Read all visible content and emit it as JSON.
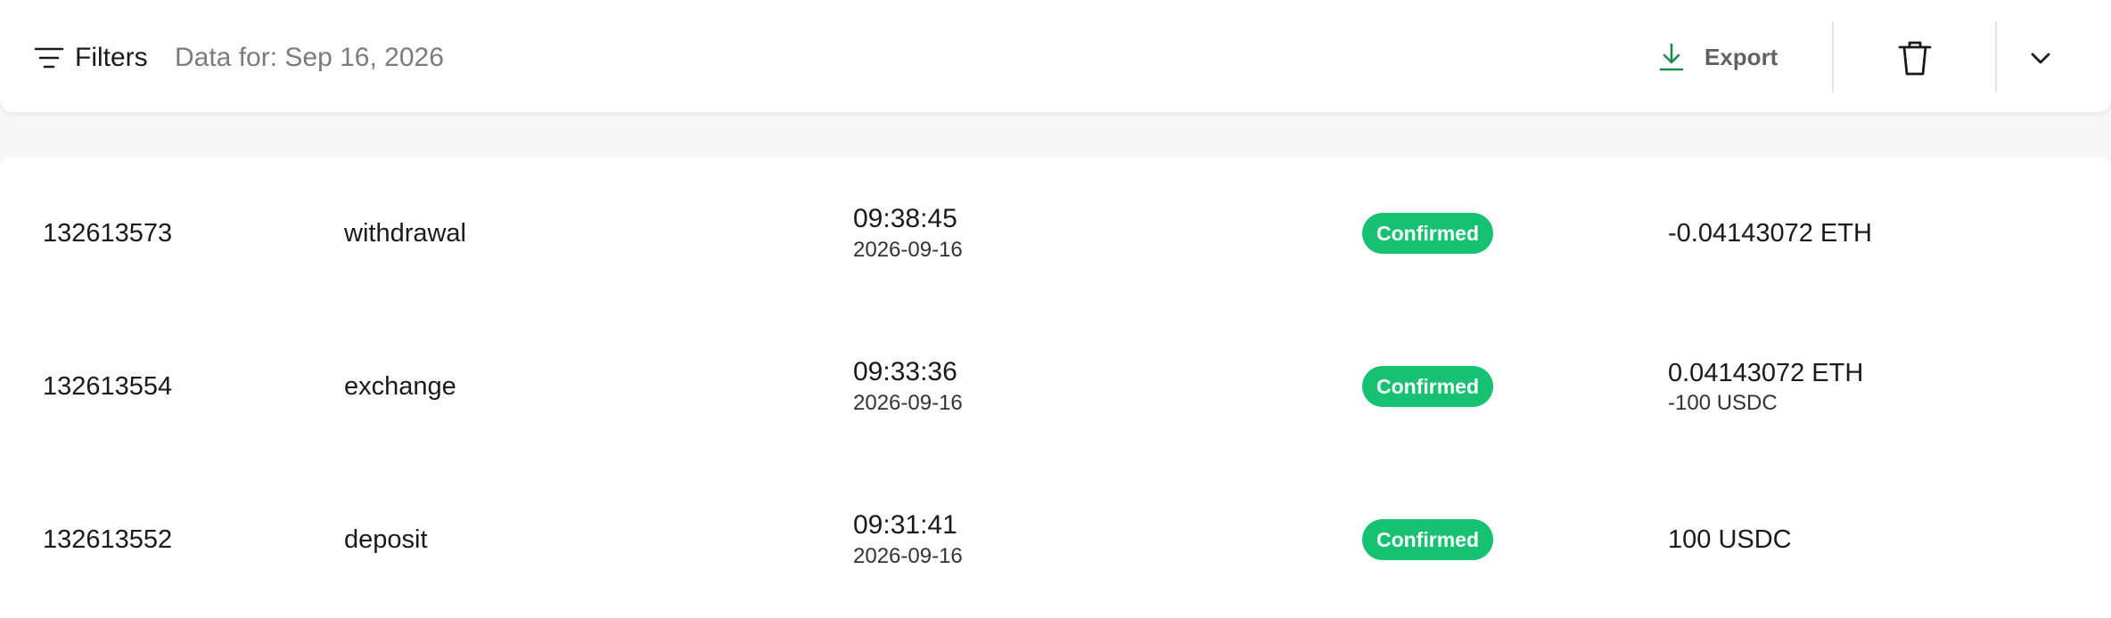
{
  "toolbar": {
    "filters_label": "Filters",
    "data_for": "Data for: Sep 16, 2026",
    "export_label": "Export"
  },
  "colors": {
    "confirmed": "#16c172",
    "export_icon": "#1b8a4f"
  },
  "icons": {
    "filters": "filter-lines-icon",
    "export": "download-icon",
    "delete": "trash-icon",
    "expand": "chevron-down-icon"
  },
  "transactions": [
    {
      "id": "132613573",
      "type": "withdrawal",
      "time": "09:38:45",
      "date": "2026-09-16",
      "status": "Confirmed",
      "amount": "-0.04143072 ETH",
      "amount_secondary": ""
    },
    {
      "id": "132613554",
      "type": "exchange",
      "time": "09:33:36",
      "date": "2026-09-16",
      "status": "Confirmed",
      "amount": "0.04143072 ETH",
      "amount_secondary": "-100 USDC"
    },
    {
      "id": "132613552",
      "type": "deposit",
      "time": "09:31:41",
      "date": "2026-09-16",
      "status": "Confirmed",
      "amount": "100 USDC",
      "amount_secondary": ""
    }
  ]
}
